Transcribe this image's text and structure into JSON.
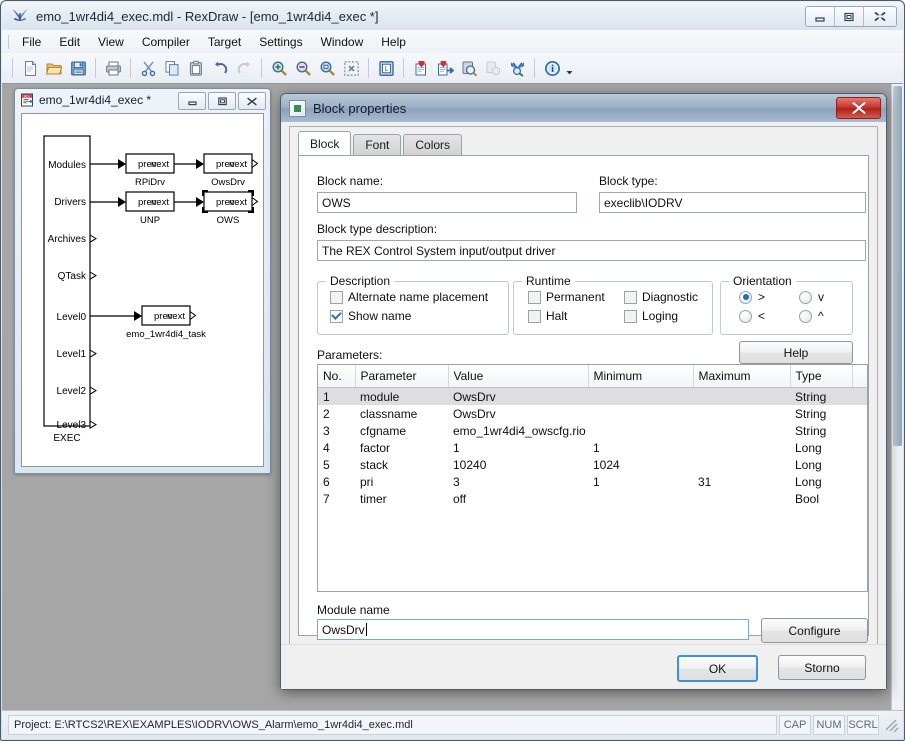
{
  "window": {
    "title": "emo_1wr4di4_exec.mdl - RexDraw - [emo_1wr4di4_exec *]",
    "icon": "rexdraw-butterfly-icon",
    "minimize": "—",
    "maximize": "❐",
    "close": "✕"
  },
  "menubar": {
    "items": [
      {
        "label": "File"
      },
      {
        "label": "Edit"
      },
      {
        "label": "View"
      },
      {
        "label": "Compiler"
      },
      {
        "label": "Target"
      },
      {
        "label": "Settings"
      },
      {
        "label": "Window"
      },
      {
        "label": "Help"
      }
    ]
  },
  "toolbar": {
    "groups": [
      {
        "tools": [
          {
            "name": "new-file-icon",
            "enabled": true
          },
          {
            "name": "open-folder-icon",
            "enabled": true
          },
          {
            "name": "save-icon",
            "enabled": true
          }
        ]
      },
      {
        "tools": [
          {
            "name": "print-icon",
            "enabled": true
          }
        ]
      },
      {
        "tools": [
          {
            "name": "cut-scissors-icon",
            "enabled": true
          },
          {
            "name": "copy-icon",
            "enabled": true
          },
          {
            "name": "paste-icon",
            "enabled": true
          },
          {
            "name": "undo-icon",
            "enabled": true
          },
          {
            "name": "redo-icon",
            "enabled": false
          }
        ]
      },
      {
        "tools": [
          {
            "name": "zoom-in-icon",
            "enabled": true
          },
          {
            "name": "zoom-out-icon",
            "enabled": true
          },
          {
            "name": "zoom-100-icon",
            "enabled": true
          },
          {
            "name": "zoom-fit-icon",
            "enabled": true
          }
        ]
      },
      {
        "tools": [
          {
            "name": "library-icon",
            "enabled": true
          }
        ]
      },
      {
        "tools": [
          {
            "name": "compile-icon",
            "enabled": true
          },
          {
            "name": "compile-download-icon",
            "enabled": true
          },
          {
            "name": "watch-icon",
            "enabled": true
          },
          {
            "name": "copy-target-icon",
            "enabled": false
          },
          {
            "name": "diagnostics-icon",
            "enabled": true
          }
        ]
      },
      {
        "tools": [
          {
            "name": "about-info-icon",
            "enabled": true
          },
          {
            "name": "chevron-down-icon",
            "enabled": true
          }
        ]
      }
    ]
  },
  "mdi_child": {
    "title": "emo_1wr4di4_exec *",
    "icon": "mdl-document-icon",
    "minimize": "—",
    "restore": "❐",
    "close": "✕",
    "diagram": {
      "exec_block": {
        "label": "EXEC",
        "ports": [
          "Modules",
          "Drivers",
          "Archives",
          "QTask",
          "Level0",
          "Level1",
          "Level2",
          "Level3"
        ]
      },
      "blocks": [
        {
          "name": "RPiDrv",
          "prev": "prev",
          "next": "next",
          "selected": false
        },
        {
          "name": "OwsDrv",
          "prev": "prev",
          "next": "next",
          "selected": false
        },
        {
          "name": "UNP",
          "prev": "prev",
          "next": "next",
          "selected": false
        },
        {
          "name": "OWS",
          "prev": "prev",
          "next": "next",
          "selected": true
        },
        {
          "name": "emo_1wr4di4_task",
          "prev": "prev",
          "next": "next",
          "selected": false
        }
      ]
    }
  },
  "dialog": {
    "title": "Block properties",
    "icon": "block-properties-icon",
    "close_label": "✕",
    "tabs": [
      {
        "label": "Block",
        "active": true
      },
      {
        "label": "Font",
        "active": false
      },
      {
        "label": "Colors",
        "active": false
      }
    ],
    "block_name_label": "Block name:",
    "block_name_value": "OWS",
    "block_type_label": "Block type:",
    "block_type_value": "execlib\\IODRV",
    "block_type_description_label": "Block type description:",
    "block_type_description_value": "The REX Control System input/output driver",
    "description_group": {
      "title": "Description",
      "checkboxes": [
        {
          "label": "Alternate name placement",
          "checked": false
        },
        {
          "label": "Show name",
          "checked": true
        }
      ]
    },
    "runtime_group": {
      "title": "Runtime",
      "checkboxes": [
        {
          "label": "Permanent",
          "checked": false
        },
        {
          "label": "Diagnostic",
          "checked": false
        },
        {
          "label": "Halt",
          "checked": false
        },
        {
          "label": "Loging",
          "checked": false
        }
      ]
    },
    "orientation_group": {
      "title": "Orientation",
      "options": [
        {
          "label": ">",
          "selected": true
        },
        {
          "label": "v",
          "selected": false
        },
        {
          "label": "<",
          "selected": false
        },
        {
          "label": "^",
          "selected": false
        }
      ]
    },
    "help_button": "Help",
    "parameters_label": "Parameters:",
    "parameters_table": {
      "columns": [
        "No.",
        "Parameter",
        "Value",
        "Minimum",
        "Maximum",
        "Type"
      ],
      "rows": [
        {
          "no": "1",
          "parameter": "module",
          "value": "OwsDrv",
          "minimum": "",
          "maximum": "",
          "type": "String",
          "selected": true
        },
        {
          "no": "2",
          "parameter": "classname",
          "value": "OwsDrv",
          "minimum": "",
          "maximum": "",
          "type": "String",
          "selected": false
        },
        {
          "no": "3",
          "parameter": "cfgname",
          "value": "emo_1wr4di4_owscfg.rio",
          "minimum": "",
          "maximum": "",
          "type": "String",
          "selected": false
        },
        {
          "no": "4",
          "parameter": "factor",
          "value": "1",
          "minimum": "1",
          "maximum": "",
          "type": "Long",
          "selected": false
        },
        {
          "no": "5",
          "parameter": "stack",
          "value": "10240",
          "minimum": "1024",
          "maximum": "",
          "type": "Long",
          "selected": false
        },
        {
          "no": "6",
          "parameter": "pri",
          "value": "3",
          "minimum": "1",
          "maximum": "31",
          "type": "Long",
          "selected": false
        },
        {
          "no": "7",
          "parameter": "timer",
          "value": "off",
          "minimum": "",
          "maximum": "",
          "type": "Bool",
          "selected": false
        }
      ]
    },
    "module_name_label": "Module name",
    "module_name_value": "OwsDrv",
    "configure_button": "Configure",
    "ok_button": "OK",
    "cancel_button": "Storno"
  },
  "statusbar": {
    "project_text": "Project: E:\\RTCS2\\REX\\EXAMPLES\\IODRV\\OWS_Alarm\\emo_1wr4di4_exec.mdl",
    "indicators": [
      "CAP",
      "NUM",
      "SCRL"
    ]
  },
  "colors": {
    "dialog_title_start": "#b9c8d8",
    "dialog_title_end": "#8ba2bb",
    "close_button_red": "#c6362c",
    "selection_row": "#dedede",
    "default_button_border": "#3c93d6",
    "mdi_background": "#a6a6a6"
  }
}
